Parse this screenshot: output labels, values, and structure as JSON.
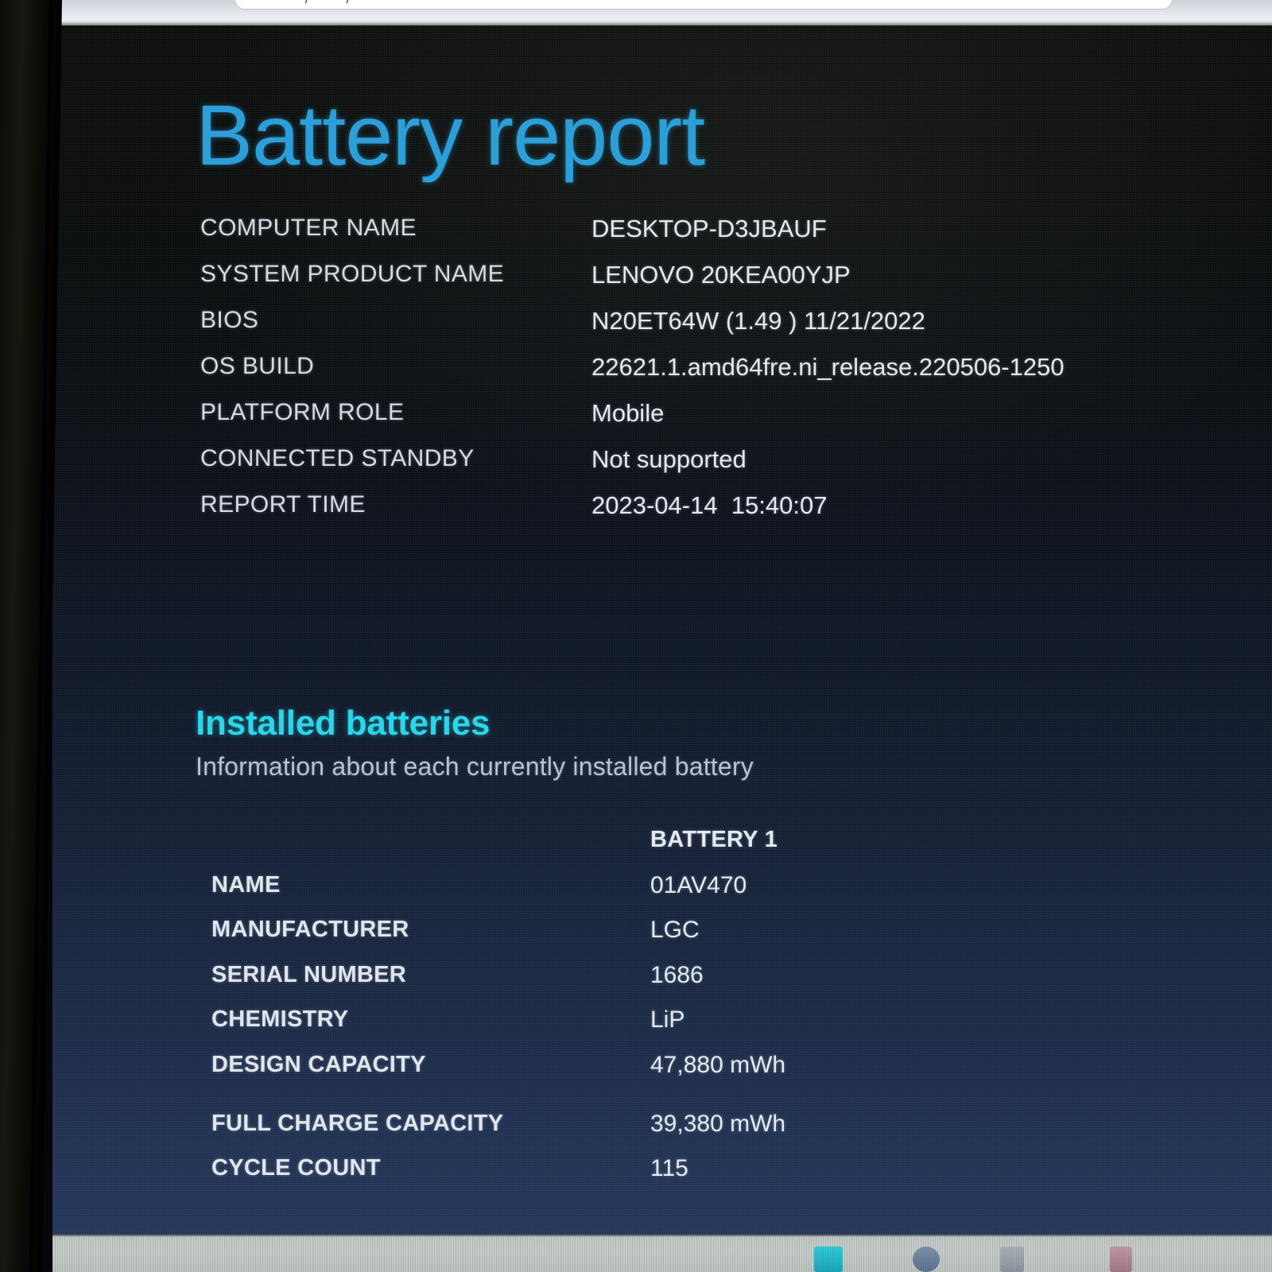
{
  "browser": {
    "omnibox_fragment": "·· ·· ·· / ·· · · /"
  },
  "report": {
    "title": "Battery report",
    "title_color": "#2c9fd9",
    "background_top_color": "#0b0e0b",
    "background_bottom_color": "#22355a"
  },
  "system_info": {
    "rows": [
      {
        "label": "COMPUTER NAME",
        "value": "DESKTOP-D3JBAUF"
      },
      {
        "label": "SYSTEM PRODUCT NAME",
        "value": "LENOVO 20KEA00YJP"
      },
      {
        "label": "BIOS",
        "value": "N20ET64W (1.49 ) 11/21/2022"
      },
      {
        "label": "OS BUILD",
        "value": "22621.1.amd64fre.ni_release.220506-1250"
      },
      {
        "label": "PLATFORM ROLE",
        "value": "Mobile"
      },
      {
        "label": "CONNECTED STANDBY",
        "value": "Not supported"
      },
      {
        "label": "REPORT TIME",
        "value": "2023-04-14  15:40:07"
      }
    ]
  },
  "installed_batteries": {
    "heading": "Installed batteries",
    "heading_color": "#2ad6ea",
    "subtitle": "Information about each currently installed battery",
    "column_header": "BATTERY 1",
    "rows": [
      {
        "label": "NAME",
        "value": "01AV470"
      },
      {
        "label": "MANUFACTURER",
        "value": "LGC"
      },
      {
        "label": "SERIAL NUMBER",
        "value": "1686"
      },
      {
        "label": "CHEMISTRY",
        "value": "LiP"
      },
      {
        "label": "DESIGN CAPACITY",
        "value": "47,880 mWh"
      },
      {
        "label": "FULL CHARGE CAPACITY",
        "value": "39,380 mWh"
      },
      {
        "label": "CYCLE COUNT",
        "value": "115"
      }
    ]
  },
  "taskbar": {
    "icons": [
      {
        "name": "teal-app-icon",
        "color": "#2fd0dd"
      },
      {
        "name": "blue-app-icon",
        "color": "#5a7190"
      },
      {
        "name": "grey-app-icon",
        "color": "#8e979f"
      },
      {
        "name": "pink-app-icon",
        "color": "#a4798a"
      }
    ]
  }
}
